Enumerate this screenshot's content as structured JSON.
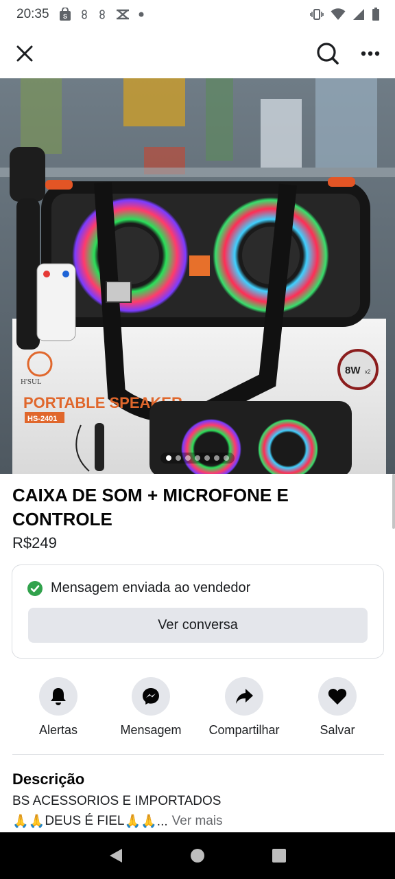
{
  "status_bar": {
    "time": "20:35",
    "left_icons": [
      "shopping-bag-icon",
      "notification-icon",
      "notification-icon",
      "missed-call-icon",
      "dot-icon"
    ],
    "right_icons": [
      "vibrate-icon",
      "wifi-icon",
      "cell-signal-icon",
      "battery-icon"
    ]
  },
  "app_bar": {
    "icons": [
      "close-icon",
      "search-icon",
      "more-icon"
    ]
  },
  "hero": {
    "image_count": 7,
    "active_index": 0,
    "box_brand": "H'SUL",
    "box_title": "PORTABLE SPEAKER",
    "box_model": "HS-2401",
    "power_badge": "8W",
    "power_badge_sub": "x2"
  },
  "listing": {
    "title": "CAIXA DE SOM + MICROFONE E CONTROLE",
    "price": "R$249"
  },
  "message": {
    "status": "Mensagem enviada ao vendedor",
    "button": "Ver conversa"
  },
  "actions": [
    {
      "label": "Alertas",
      "icon": "bell-icon"
    },
    {
      "label": "Mensagem",
      "icon": "messenger-icon"
    },
    {
      "label": "Compartilhar",
      "icon": "share-icon"
    },
    {
      "label": "Salvar",
      "icon": "heart-icon"
    }
  ],
  "description": {
    "heading": "Descrição",
    "line1": "BS ACESSORIOS E IMPORTADOS",
    "line2_prefix": "🙏🙏",
    "line2_text": "DEUS É FIEL",
    "line2_suffix": "🙏🙏...",
    "more": "Ver mais"
  },
  "colors": {
    "accent_green": "#31a24c",
    "button_gray": "#e4e6eb",
    "text_secondary": "#65676b"
  }
}
